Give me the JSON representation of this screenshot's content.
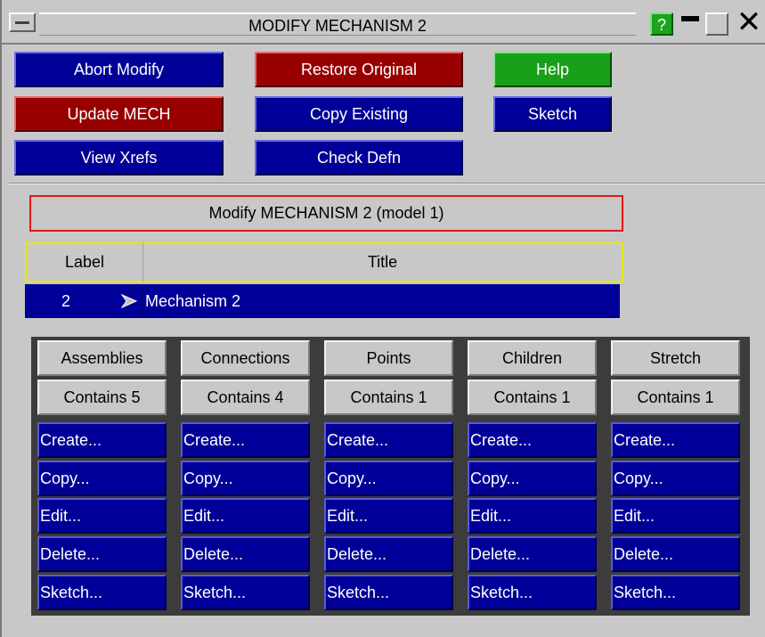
{
  "window": {
    "title": "MODIFY MECHANISM 2",
    "help_glyph": "?",
    "close_glyph": "✕"
  },
  "toolbar": {
    "abort_modify": "Abort Modify",
    "restore_original": "Restore Original",
    "help": "Help",
    "update_mech": "Update MECH",
    "copy_existing": "Copy Existing",
    "sketch": "Sketch",
    "view_xrefs": "View Xrefs",
    "check_defn": "Check Defn"
  },
  "colors": {
    "button_blue": "#000098",
    "button_red": "#980000",
    "button_green": "#18a018",
    "panel_gray": "#c8c8c8",
    "frame_red": "#e01818",
    "header_yellow": "#e8e800"
  },
  "heading": "Modify MECHANISM 2 (model 1)",
  "table": {
    "headers": {
      "label": "Label",
      "title": "Title"
    },
    "row": {
      "label": "2",
      "title": "Mechanism 2"
    }
  },
  "columns": [
    {
      "name": "Assemblies",
      "count": "Contains 5",
      "actions": [
        "Create...",
        "Copy...",
        "Edit...",
        "Delete...",
        "Sketch..."
      ]
    },
    {
      "name": "Connections",
      "count": "Contains 4",
      "actions": [
        "Create...",
        "Copy...",
        "Edit...",
        "Delete...",
        "Sketch..."
      ]
    },
    {
      "name": "Points",
      "count": "Contains 1",
      "actions": [
        "Create...",
        "Copy...",
        "Edit...",
        "Delete...",
        "Sketch..."
      ]
    },
    {
      "name": "Children",
      "count": "Contains 1",
      "actions": [
        "Create...",
        "Copy...",
        "Edit...",
        "Delete...",
        "Sketch..."
      ]
    },
    {
      "name": "Stretch",
      "count": "Contains 1",
      "actions": [
        "Create...",
        "Copy...",
        "Edit...",
        "Delete...",
        "Sketch..."
      ]
    }
  ]
}
